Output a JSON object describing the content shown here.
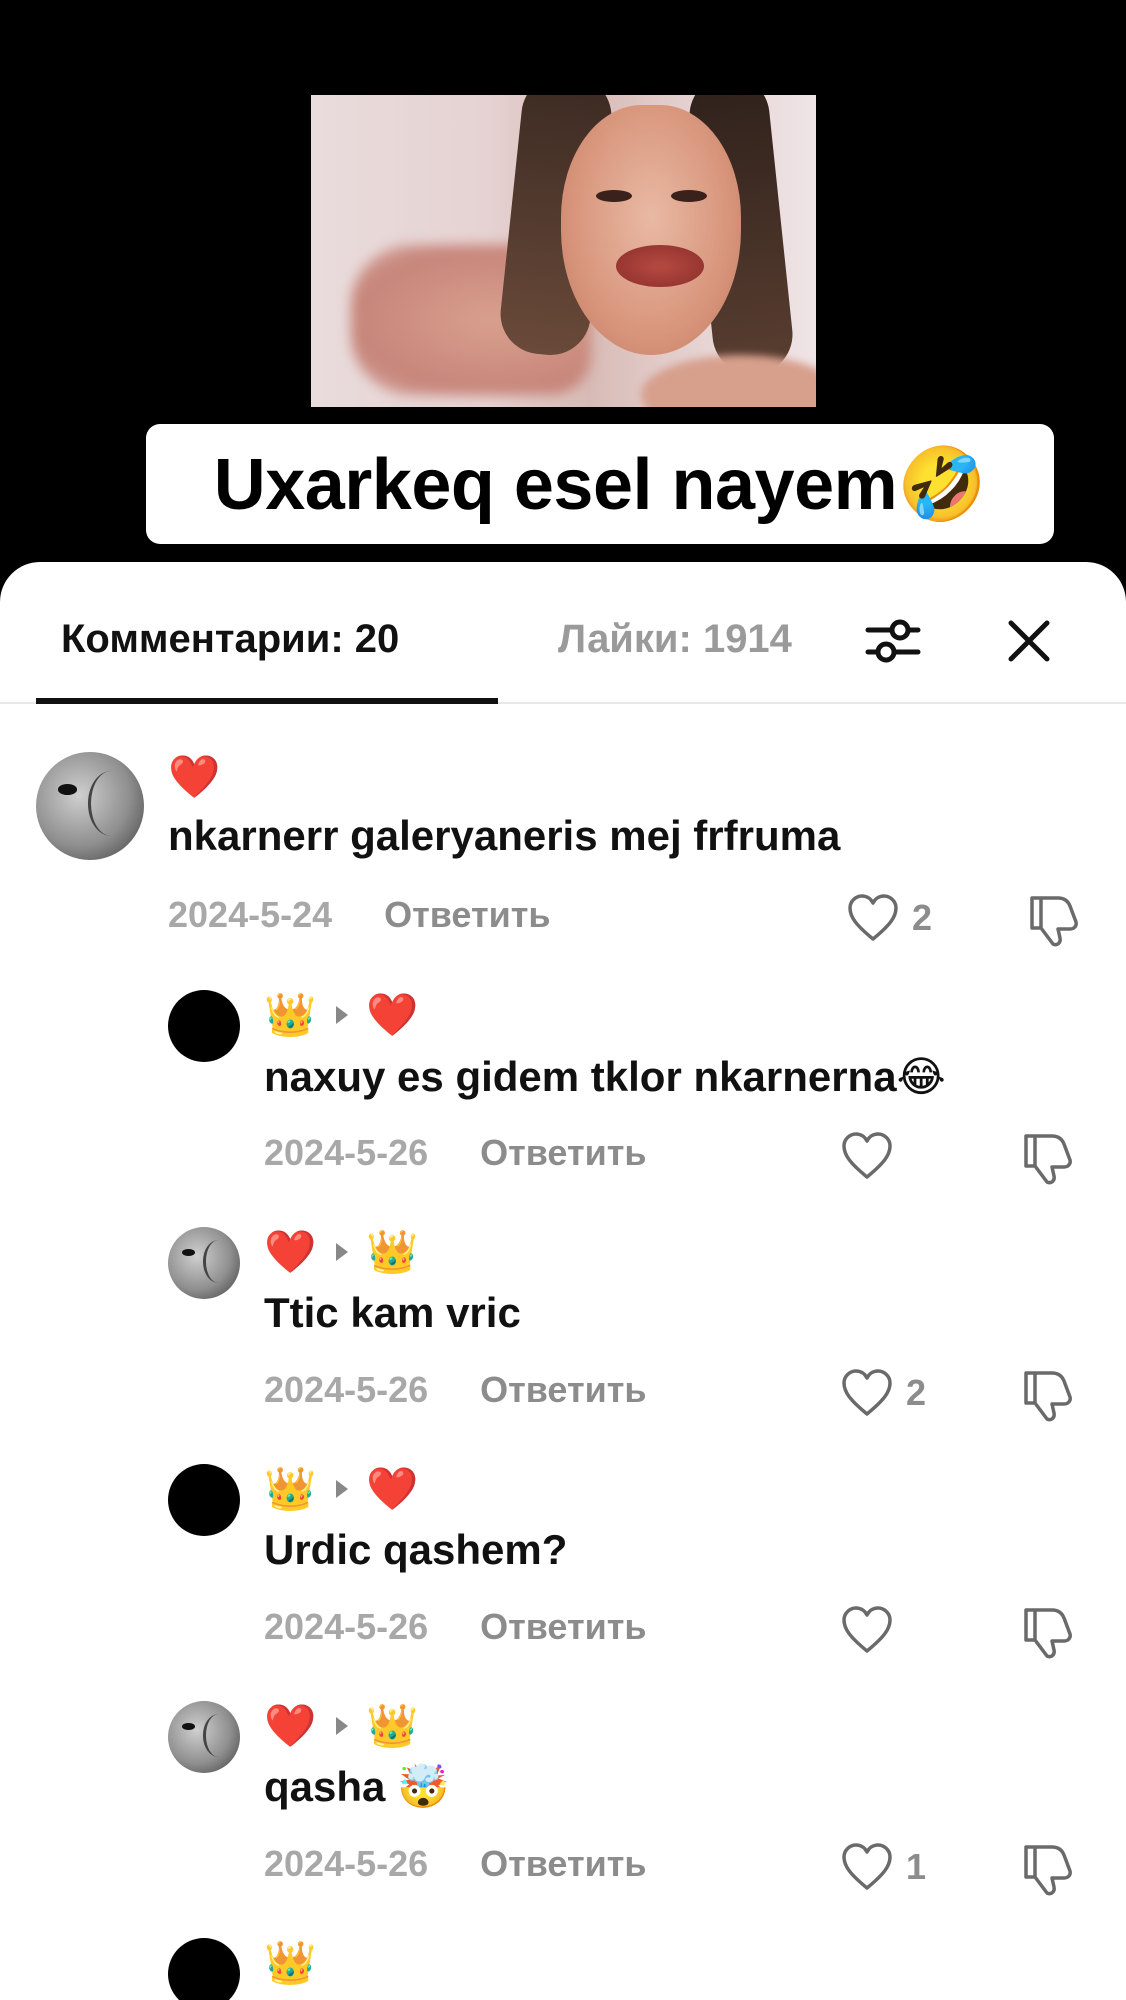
{
  "video": {
    "caption": "Uxarkeq esel nayem🤣"
  },
  "sheet": {
    "tab_comments": "Комментарии: 20",
    "tab_likes": "Лайки: 1914",
    "filter_icon": "sliders-icon",
    "close_icon": "close-icon"
  },
  "comments": [
    {
      "avatar": "lion",
      "names": [
        "❤️"
      ],
      "text": "nkarnerr galeryaneris mej frfruma",
      "date": "2024-5-24",
      "reply": "Ответить",
      "likes": "2"
    },
    {
      "avatar": "dark",
      "names": [
        "👑",
        "❤️"
      ],
      "text": "naxuy es gidem tklor nkarnerna😂",
      "date": "2024-5-26",
      "reply": "Ответить",
      "likes": ""
    },
    {
      "avatar": "lion",
      "names": [
        "❤️",
        "👑"
      ],
      "text": "Ttic kam vric",
      "date": "2024-5-26",
      "reply": "Ответить",
      "likes": "2"
    },
    {
      "avatar": "dark",
      "names": [
        "👑",
        "❤️"
      ],
      "text": "Urdic qashem?",
      "date": "2024-5-26",
      "reply": "Ответить",
      "likes": ""
    },
    {
      "avatar": "lion",
      "names": [
        "❤️",
        "👑"
      ],
      "text": "qasha 🤯",
      "date": "2024-5-26",
      "reply": "Ответить",
      "likes": "1"
    },
    {
      "avatar": "dark",
      "names": [
        "👑"
      ],
      "text": "",
      "date": "",
      "reply": "",
      "likes": ""
    }
  ]
}
